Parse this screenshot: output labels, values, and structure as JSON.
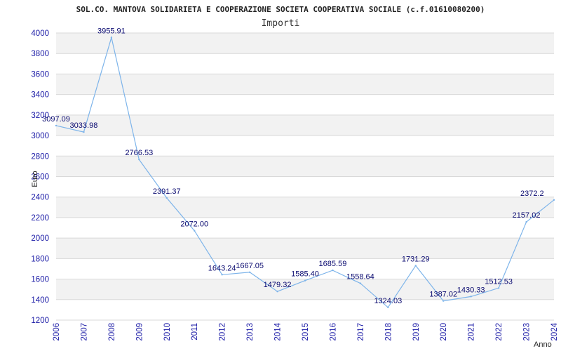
{
  "chart_data": {
    "type": "line",
    "title": "SOL.CO. MANTOVA SOLIDARIETA E COOPERAZIONE SOCIETA COOPERATIVA SOCIALE (c.f.01610080200)",
    "subtitle": "Importi",
    "xlabel": "Anno",
    "ylabel": "Euro",
    "ylim": [
      1200,
      4000
    ],
    "yticks": [
      1200,
      1400,
      1600,
      1800,
      2000,
      2200,
      2400,
      2600,
      2800,
      3000,
      3200,
      3400,
      3600,
      3800,
      4000
    ],
    "grid": true,
    "colors": {
      "line": "#7db4ea",
      "band": "#f2f2f2",
      "grid": "#d9d9d9",
      "tick_text": "#1a1aa6",
      "label_text": "#0a0a70"
    },
    "x": [
      "2006",
      "2007",
      "2008",
      "2009",
      "2010",
      "2011",
      "2012",
      "2013",
      "2014",
      "2015",
      "2016",
      "2017",
      "2018",
      "2019",
      "2020",
      "2021",
      "2022",
      "2023",
      "2024"
    ],
    "values": [
      3097.09,
      3033.98,
      3955.91,
      2766.53,
      2391.37,
      2072.0,
      1643.24,
      1667.05,
      1479.32,
      1585.4,
      1685.59,
      1558.64,
      1324.03,
      1731.29,
      1387.02,
      1430.33,
      1512.53,
      2157.02,
      2372.2
    ],
    "value_labels": [
      "3097.09",
      "3033.98",
      "3955.91",
      "2766.53",
      "2391.37",
      "2072.00",
      "1643.24",
      "1667.05",
      "1479.32",
      "1585.40",
      "1685.59",
      "1558.64",
      "1324.03",
      "1731.29",
      "1387.02",
      "1430.33",
      "1512.53",
      "2157.02",
      "2372.2"
    ]
  }
}
